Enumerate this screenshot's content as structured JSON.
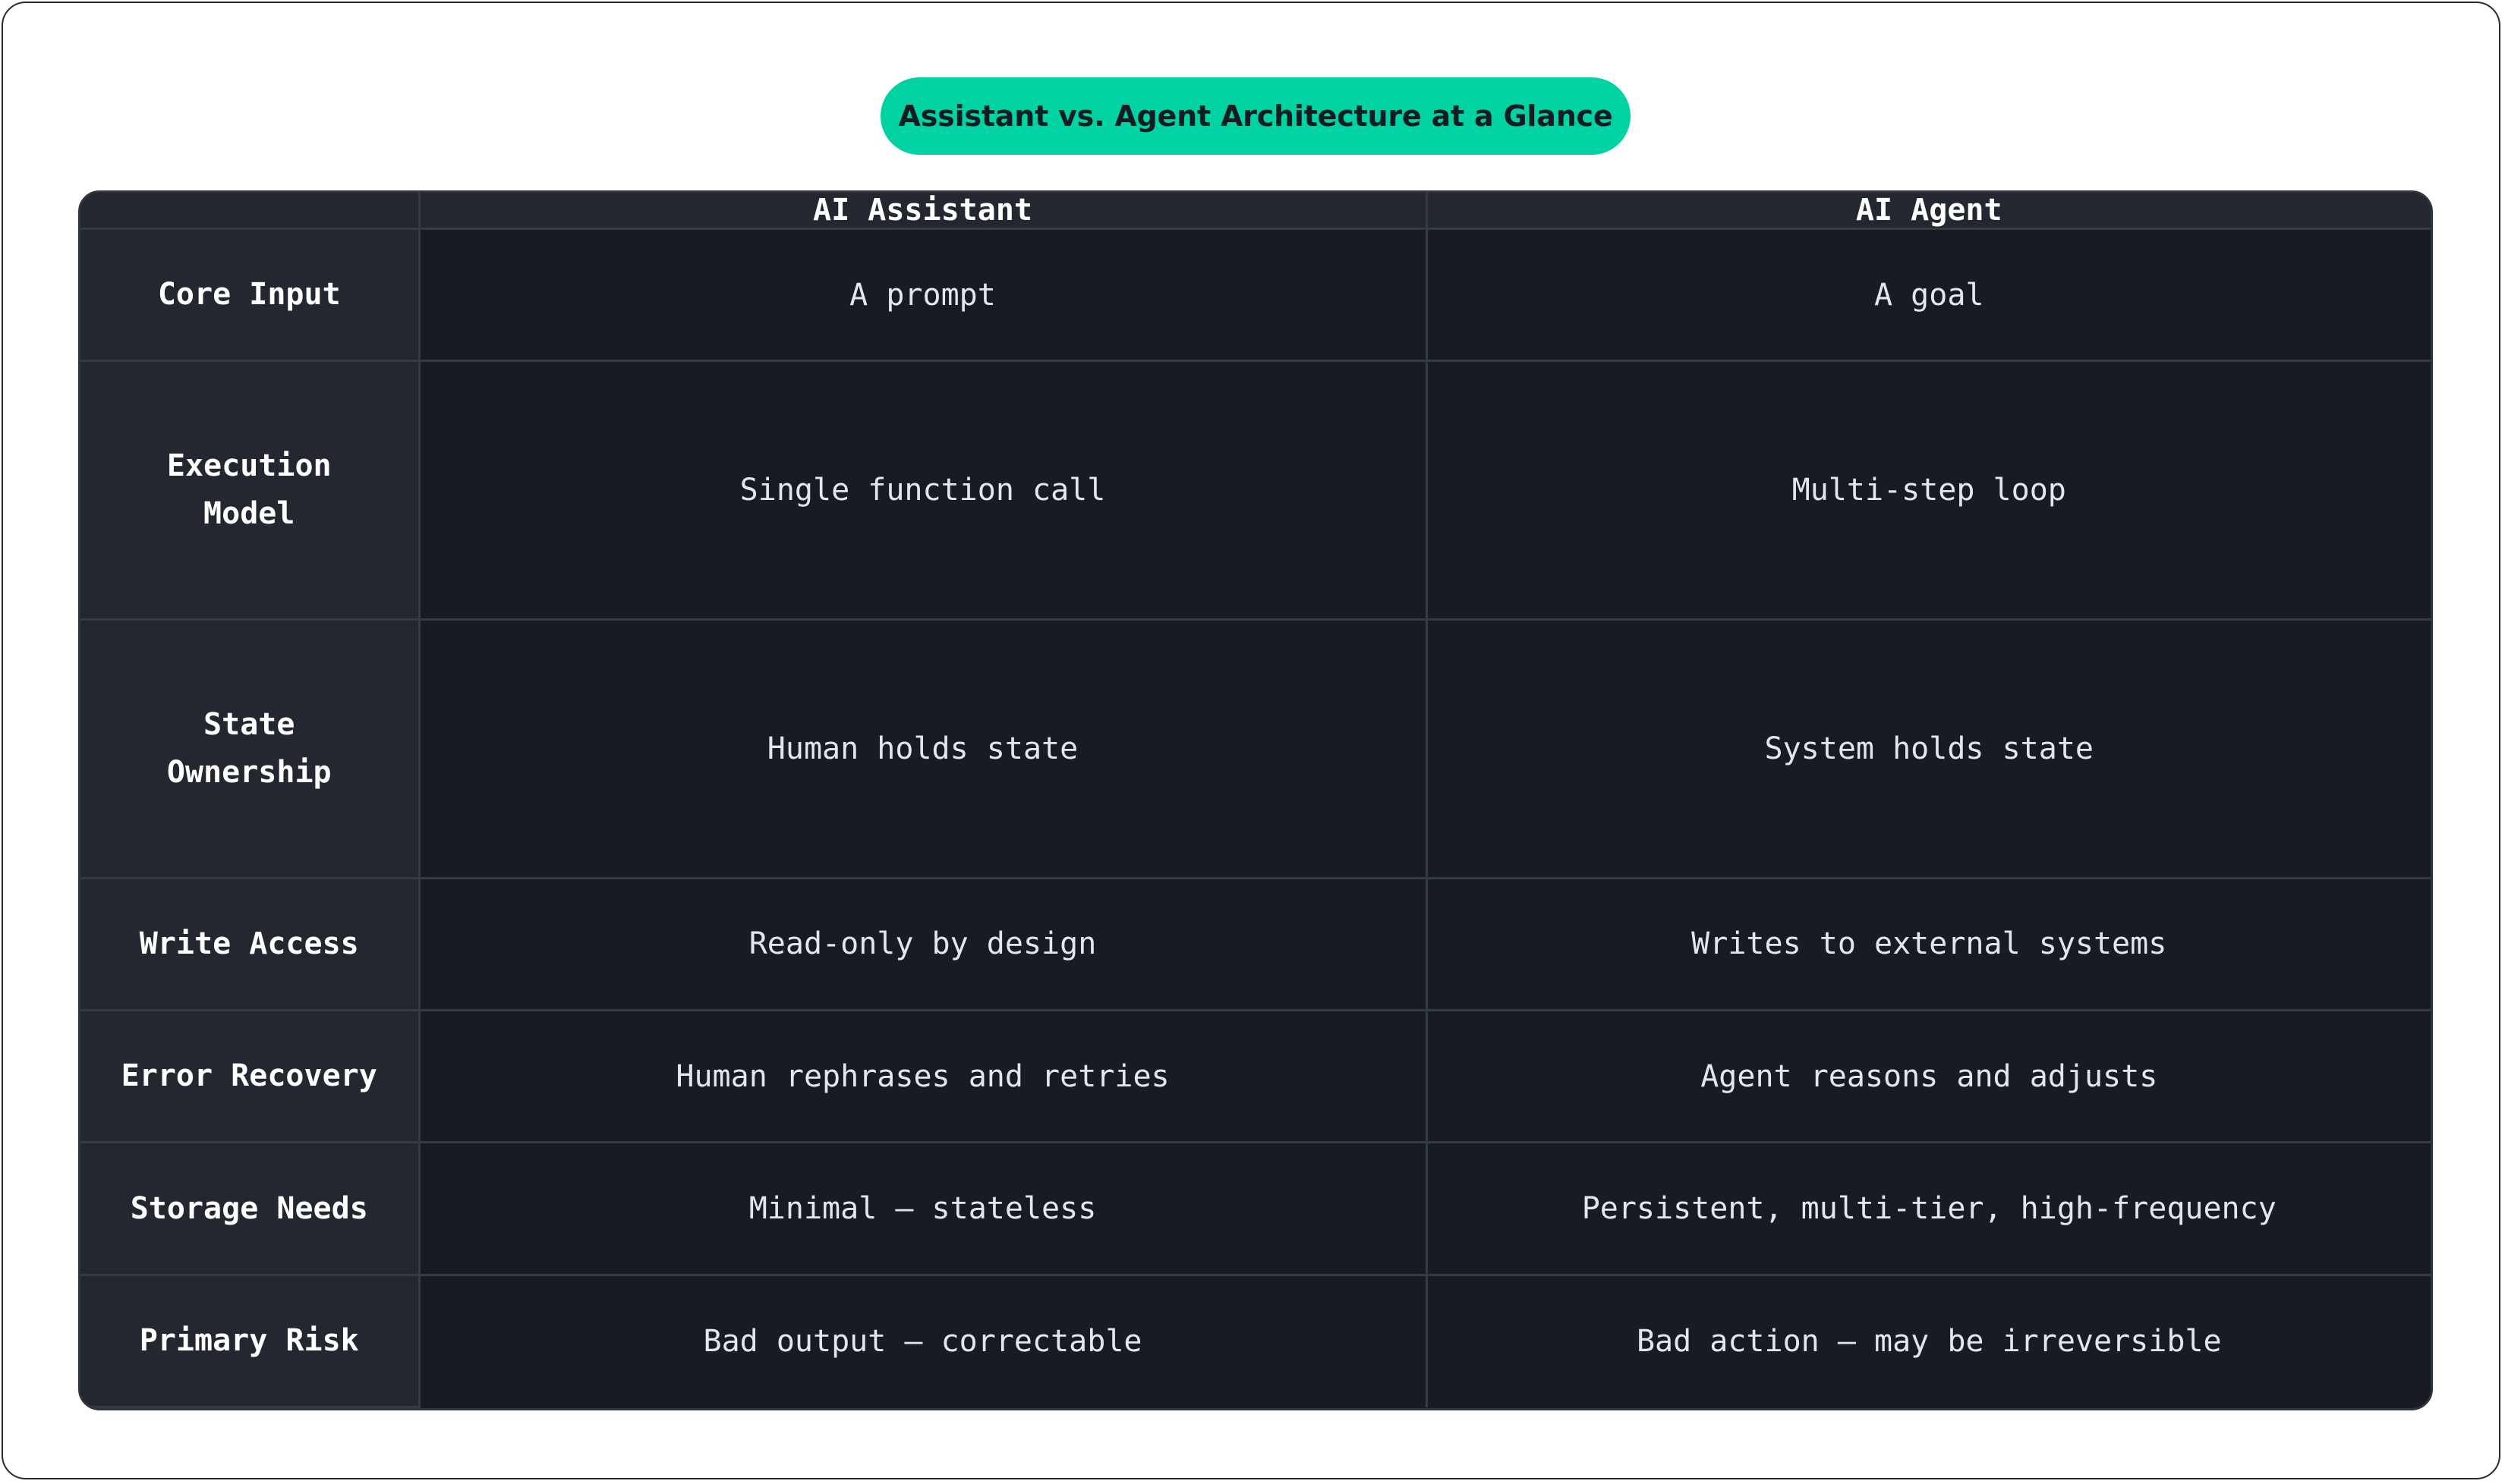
{
  "title": "Assistant vs. Agent Architecture at a Glance",
  "chart_data": {
    "type": "table",
    "title": "Assistant vs. Agent Architecture at a Glance",
    "columns": [
      "",
      "AI Assistant",
      "AI Agent"
    ],
    "rows": [
      {
        "label": "Core Input",
        "assistant": "A prompt",
        "agent": "A goal"
      },
      {
        "label": "Execution Model",
        "assistant": "Single function call",
        "agent": "Multi-step loop"
      },
      {
        "label": "State Ownership",
        "assistant": "Human holds state",
        "agent": "System holds state"
      },
      {
        "label": "Write Access",
        "assistant": "Read-only by design",
        "agent": "Writes to external systems"
      },
      {
        "label": "Error Recovery",
        "assistant": "Human rephrases and retries",
        "agent": "Agent reasons and adjusts"
      },
      {
        "label": "Storage Needs",
        "assistant": "Minimal — stateless",
        "agent": "Persistent, multi-tier, high-frequency"
      },
      {
        "label": "Primary Risk",
        "assistant": "Bad output — correctable",
        "agent": "Bad action — may be irreversible"
      }
    ]
  },
  "colors": {
    "accent": "#00d2a3",
    "header_bg": "#232830",
    "cell_bg": "#171b22",
    "grid": "#343b44",
    "text": "#e8ebee"
  }
}
